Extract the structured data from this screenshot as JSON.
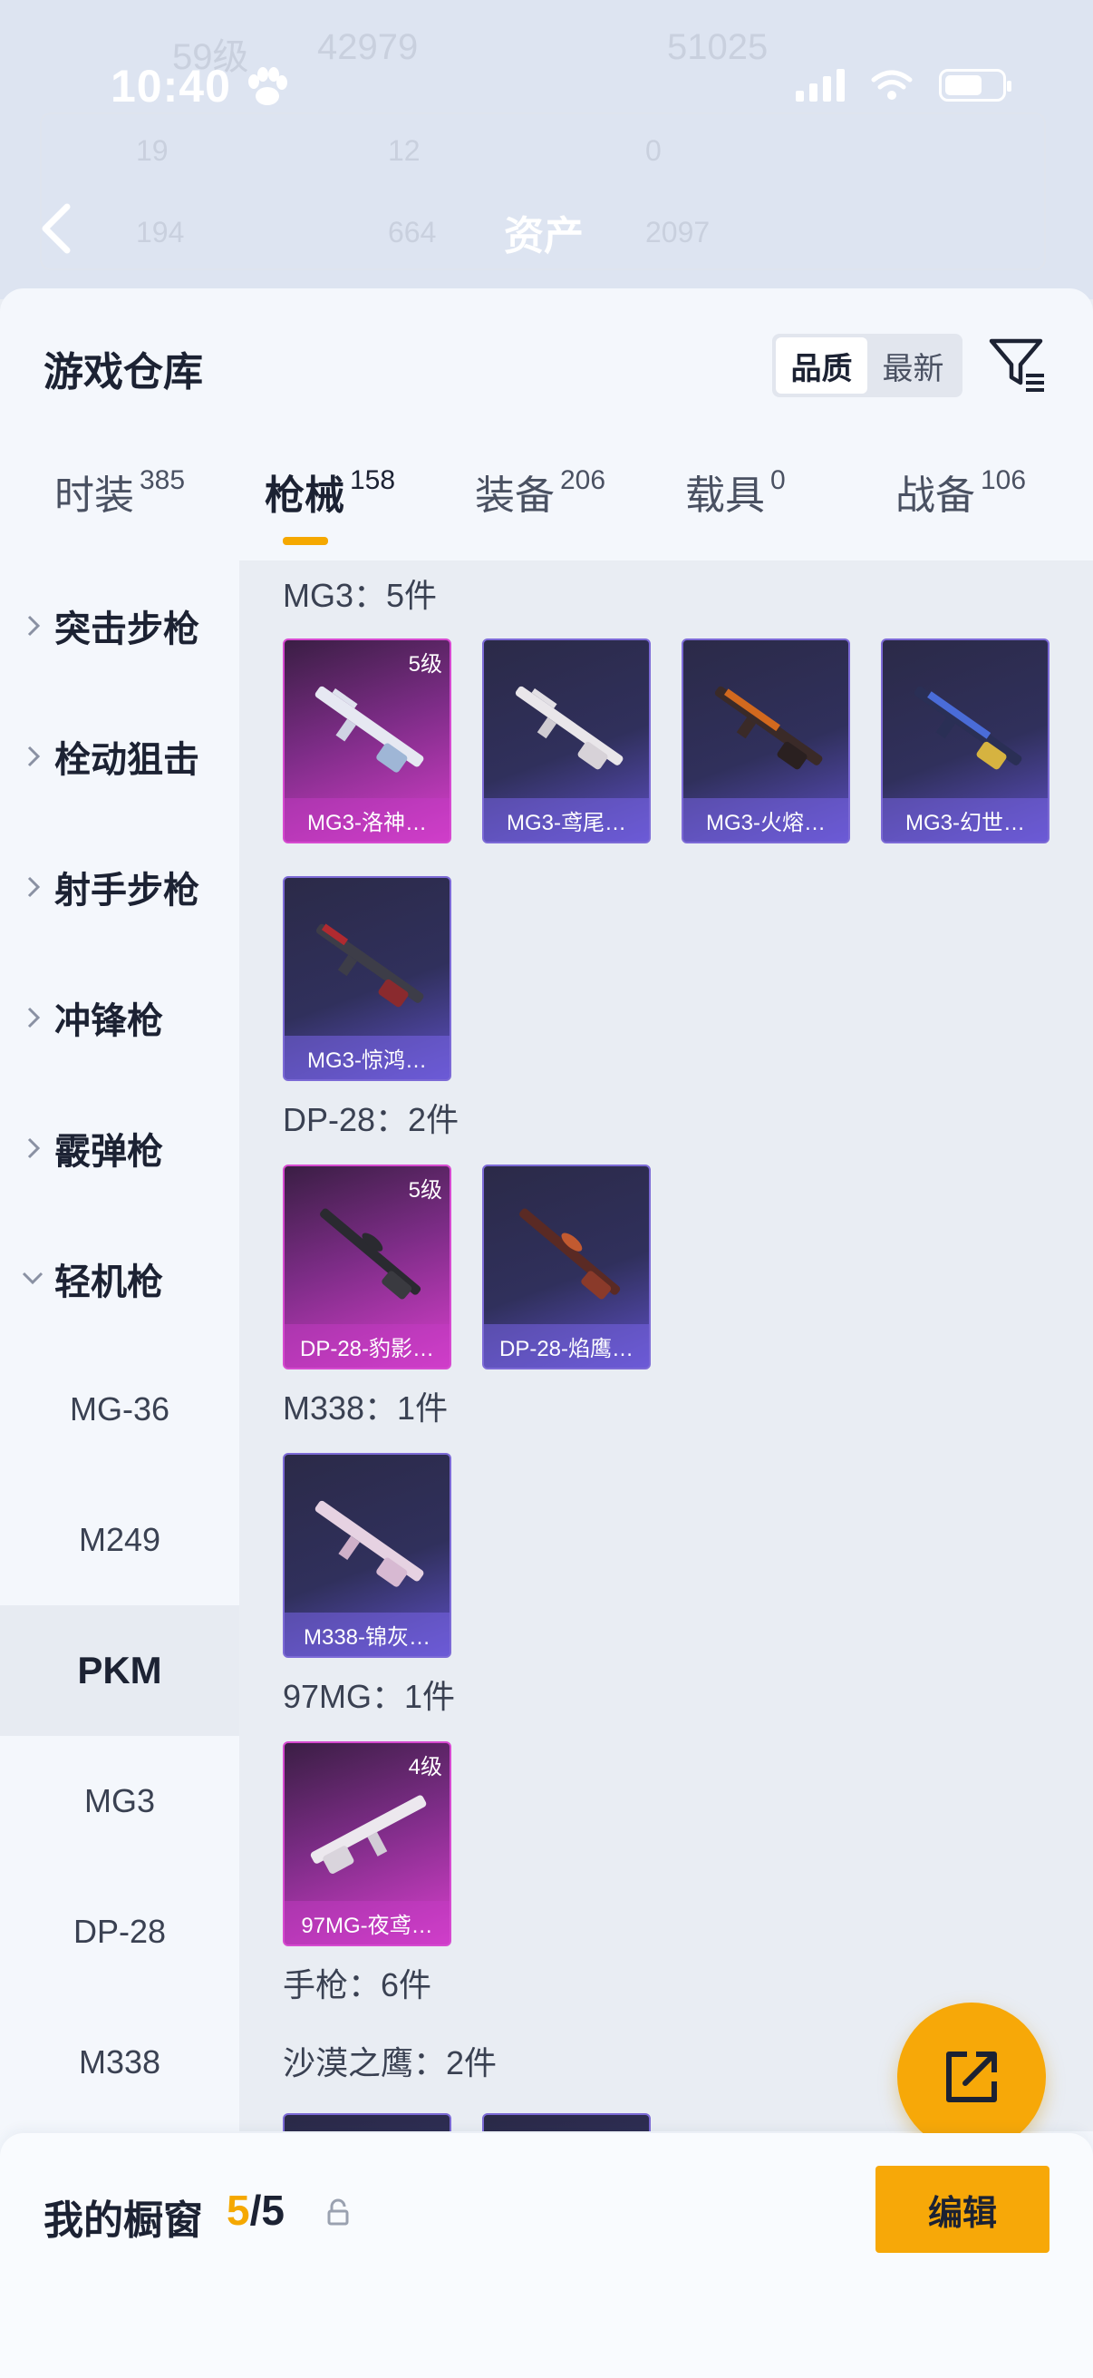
{
  "status_bar": {
    "time": "10:40"
  },
  "background_header": {
    "title": "资产",
    "faded_stats": [
      "59级",
      "42979",
      "51025",
      "19",
      "12",
      "0",
      "194",
      "664",
      "2097"
    ]
  },
  "warehouse": {
    "title": "游戏仓库",
    "sort_options": [
      "品质",
      "最新"
    ],
    "active_sort": "品质"
  },
  "tabs": [
    {
      "label": "时装",
      "count": "385"
    },
    {
      "label": "枪械",
      "count": "158"
    },
    {
      "label": "装备",
      "count": "206"
    },
    {
      "label": "载具",
      "count": "0"
    },
    {
      "label": "战备",
      "count": "106"
    }
  ],
  "categories": [
    "突击步枪",
    "栓动狙击",
    "射手步枪",
    "冲锋枪",
    "霰弹枪",
    "轻机枪"
  ],
  "subcategories": [
    "MG-36",
    "M249",
    "PKM",
    "MG3",
    "DP-28",
    "M338"
  ],
  "groups": [
    {
      "title": "MG3：5件"
    },
    {
      "title": "DP-28：2件"
    },
    {
      "title": "M338：1件"
    },
    {
      "title": "97MG：1件"
    },
    {
      "title": "手枪：6件"
    },
    {
      "title": "沙漠之鹰：2件"
    }
  ],
  "cards": [
    {
      "name": "MG3-洛神…",
      "level": "5级",
      "color": "#d63fcb"
    },
    {
      "name": "MG3-鸢尾…",
      "level": "",
      "color": "#5d4fc4"
    },
    {
      "name": "MG3-火熔…",
      "level": "",
      "color": "#5d4fc4"
    },
    {
      "name": "MG3-幻世…",
      "level": "",
      "color": "#5d4fc4"
    },
    {
      "name": "MG3-惊鸿…",
      "level": "",
      "color": "#5d4fc4"
    },
    {
      "name": "DP-28-豹影…",
      "level": "5级",
      "color": "#d63fcb"
    },
    {
      "name": "DP-28-焰鹰…",
      "level": "",
      "color": "#5d4fc4"
    },
    {
      "name": "M338-锦灰…",
      "level": "",
      "color": "#5d4fc4"
    },
    {
      "name": "97MG-夜鸢…",
      "level": "4级",
      "color": "#d63fcb"
    }
  ],
  "showcase": {
    "title": "我的橱窗",
    "current": "5",
    "max": "/5",
    "edit_label": "编辑"
  },
  "accent_color": "#f7a808"
}
